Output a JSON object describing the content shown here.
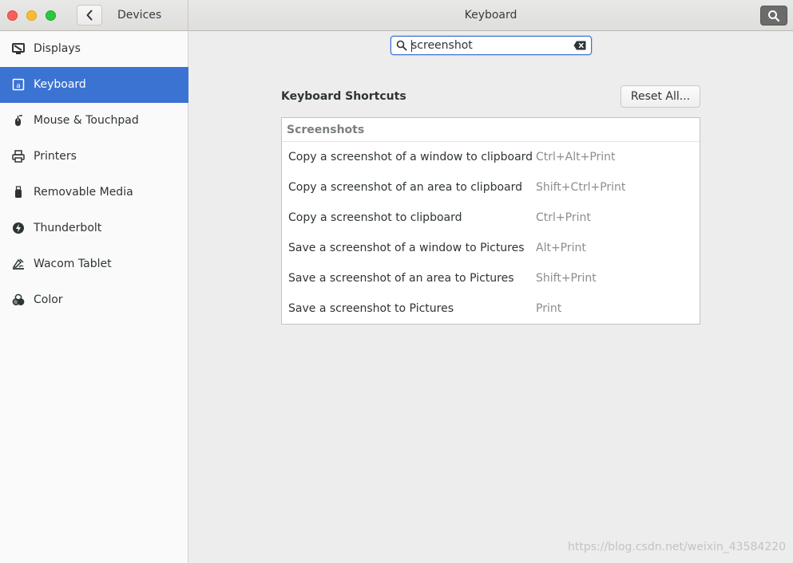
{
  "window": {
    "back_button_icon": "chevron-left-icon",
    "sidebar_title": "Devices",
    "title": "Keyboard",
    "search_button_icon": "search-icon"
  },
  "sidebar": {
    "items": [
      {
        "label": "Displays",
        "icon": "display-icon"
      },
      {
        "label": "Keyboard",
        "icon": "keyboard-icon",
        "active": true
      },
      {
        "label": "Mouse & Touchpad",
        "icon": "mouse-icon"
      },
      {
        "label": "Printers",
        "icon": "printer-icon"
      },
      {
        "label": "Removable Media",
        "icon": "usb-drive-icon"
      },
      {
        "label": "Thunderbolt",
        "icon": "thunderbolt-icon"
      },
      {
        "label": "Wacom Tablet",
        "icon": "tablet-icon"
      },
      {
        "label": "Color",
        "icon": "color-icon"
      }
    ]
  },
  "search": {
    "value": "screenshot"
  },
  "section": {
    "title": "Keyboard Shortcuts",
    "reset_label": "Reset All..."
  },
  "shortcuts": {
    "group_label": "Screenshots",
    "rows": [
      {
        "description": "Copy a screenshot of a window to clipboard",
        "accel": "Ctrl+Alt+Print"
      },
      {
        "description": "Copy a screenshot of an area to clipboard",
        "accel": "Shift+Ctrl+Print"
      },
      {
        "description": "Copy a screenshot to clipboard",
        "accel": "Ctrl+Print"
      },
      {
        "description": "Save a screenshot of a window to Pictures",
        "accel": "Alt+Print"
      },
      {
        "description": "Save a screenshot of an area to Pictures",
        "accel": "Shift+Print"
      },
      {
        "description": "Save a screenshot to Pictures",
        "accel": "Print"
      }
    ]
  },
  "watermark": "https://blog.csdn.net/weixin_43584220",
  "colors": {
    "accent": "#3b73d2",
    "close": "#fc5f57",
    "minimize": "#fdbc2e",
    "maximize": "#28c840"
  }
}
